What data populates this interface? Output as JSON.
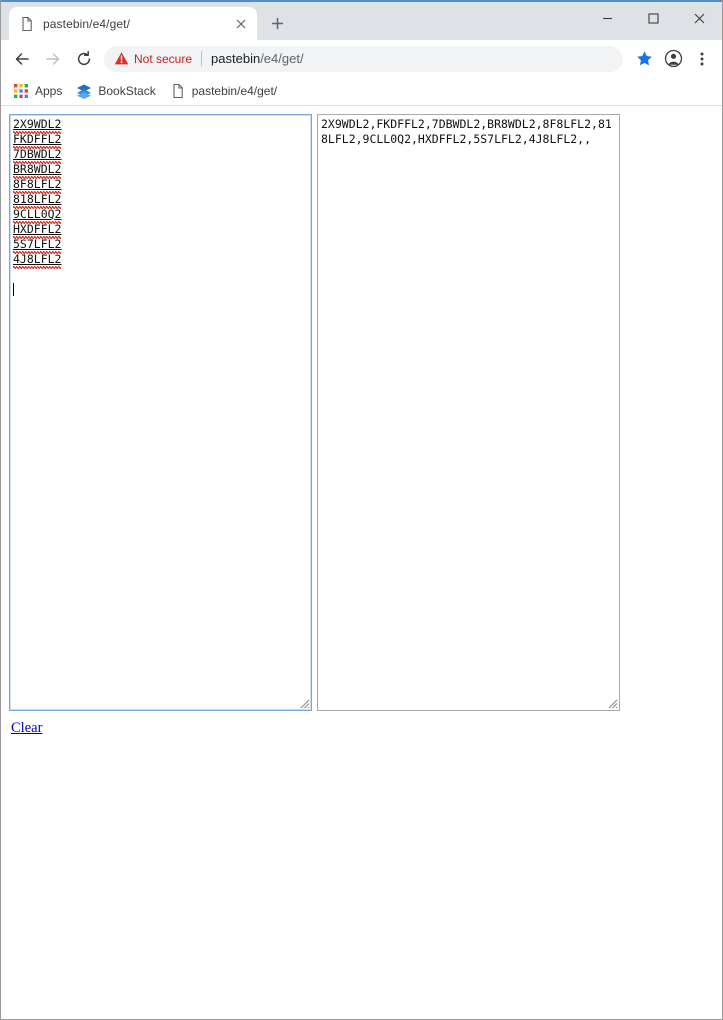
{
  "window": {
    "controls": {
      "minimize": "minimize-button",
      "maximize": "maximize-button",
      "close": "close-button"
    }
  },
  "browser": {
    "tab": {
      "title": "pastebin/e4/get/",
      "favicon": "page-icon",
      "close_label": "×"
    },
    "new_tab_label": "+",
    "toolbar": {
      "back": "back-arrow-icon",
      "forward": "forward-arrow-icon",
      "reload": "reload-icon",
      "security_text": "Not secure",
      "security_icon": "warning-triangle-icon",
      "url_host": "pastebin",
      "url_path": "/e4/get/",
      "bookmark_star": "star-icon",
      "profile": "profile-avatar-icon",
      "menu": "three-dot-menu-icon"
    },
    "bookmarks": [
      {
        "label": "Apps",
        "icon": "apps-grid-icon"
      },
      {
        "label": "BookStack",
        "icon": "bookstack-layers-icon"
      },
      {
        "label": "pastebin/e4/get/",
        "icon": "page-icon"
      }
    ]
  },
  "page": {
    "input_panel": {
      "codes": [
        "2X9WDL2",
        "FKDFFL2",
        "7DBWDL2",
        "BR8WDL2",
        "8F8LFL2",
        "818LFL2",
        "9CLL0Q2",
        "HXDFFL2",
        "5S7LFL2",
        "4J8LFL2"
      ]
    },
    "output_panel": {
      "text": "2X9WDL2,FKDFFL2,7DBWDL2,BR8WDL2,8F8LFL2,818LFL2,9CLL0Q2,HXDFFL2,5S7LFL2,4J8LFL2,,"
    },
    "clear_link": "Clear"
  }
}
